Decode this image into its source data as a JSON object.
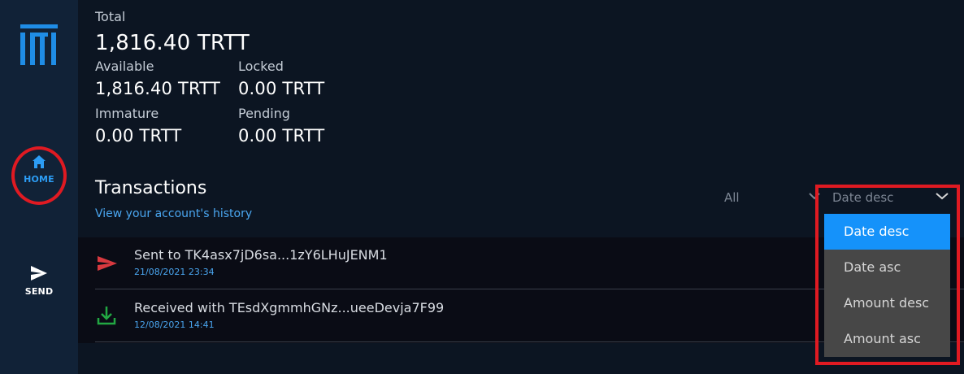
{
  "sidebar": {
    "items": [
      {
        "label": "HOME",
        "icon": "home-icon"
      },
      {
        "label": "SEND",
        "icon": "send-icon"
      }
    ]
  },
  "balances": {
    "total_label": "Total",
    "total_value": "1,816.40 TRTT",
    "available_label": "Available",
    "available_value": "1,816.40 TRTT",
    "locked_label": "Locked",
    "locked_value": "0.00 TRTT",
    "immature_label": "Immature",
    "immature_value": "0.00 TRTT",
    "pending_label": "Pending",
    "pending_value": "0.00 TRTT"
  },
  "transactions": {
    "title": "Transactions",
    "subtitle": "View your account's history",
    "filter_value": "All",
    "sort_value": "Date desc",
    "items": [
      {
        "description": "Sent to TK4asx7jD6sa...1zY6LHuJENM1",
        "date": "21/08/2021 23:34",
        "icon": "sent-arrow-icon"
      },
      {
        "description": "Received with TEsdXgmmhGNz...ueeDevja7F99",
        "date": "12/08/2021 14:41",
        "icon": "download-icon"
      }
    ]
  },
  "sort_dropdown": {
    "options": [
      "Date desc",
      "Date asc",
      "Amount desc",
      "Amount asc"
    ],
    "selected": "Date desc"
  },
  "colors": {
    "accent": "#2c9df5",
    "sent": "#d8393f",
    "received": "#22a843",
    "highlight": "#e01a22",
    "dropdown_selected": "#1592fa"
  }
}
